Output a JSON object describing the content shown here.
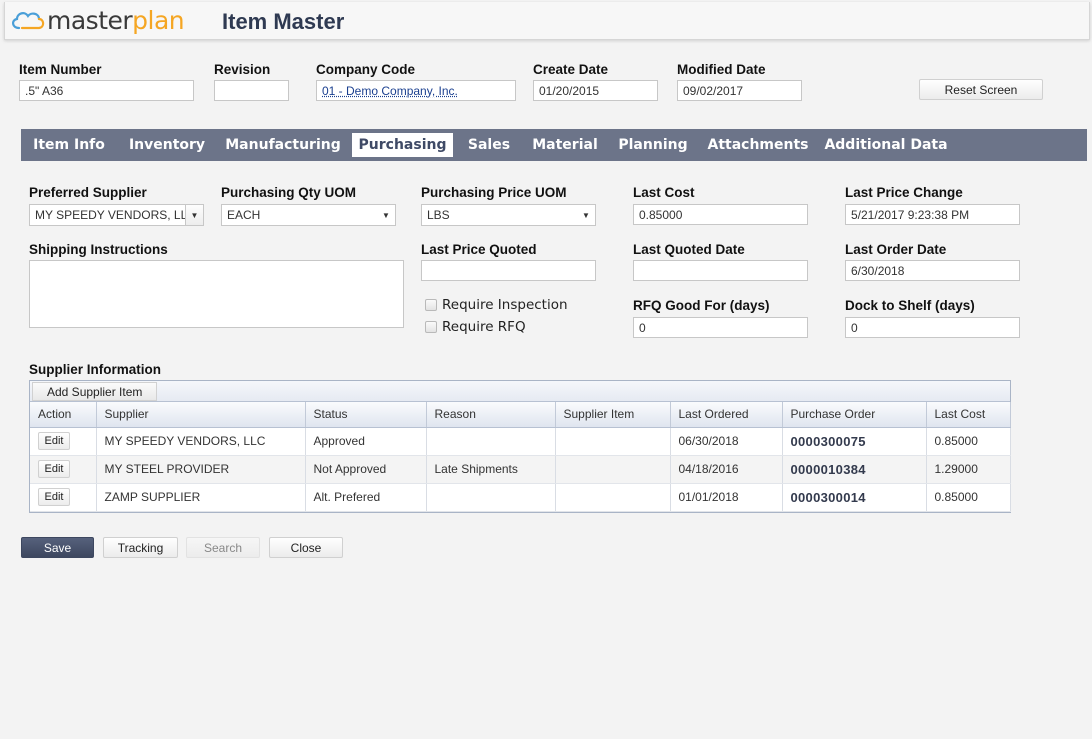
{
  "header": {
    "logo_prefix": "master",
    "logo_suffix": "plan",
    "title": "Item Master"
  },
  "top": {
    "item_number": {
      "label": "Item Number",
      "value": ".5\" A36"
    },
    "revision": {
      "label": "Revision",
      "value": ""
    },
    "company_code": {
      "label": "Company Code",
      "value": "01 - Demo Company, Inc."
    },
    "create_date": {
      "label": "Create Date",
      "value": "01/20/2015"
    },
    "modified_date": {
      "label": "Modified Date",
      "value": "09/02/2017"
    },
    "reset_button": "Reset Screen"
  },
  "tabs": [
    {
      "label": "Item Info",
      "active": false
    },
    {
      "label": "Inventory",
      "active": false
    },
    {
      "label": "Manufacturing",
      "active": false
    },
    {
      "label": "Purchasing",
      "active": true
    },
    {
      "label": "Sales",
      "active": false
    },
    {
      "label": "Material",
      "active": false
    },
    {
      "label": "Planning",
      "active": false
    },
    {
      "label": "Attachments",
      "active": false
    },
    {
      "label": "Additional Data",
      "active": false
    }
  ],
  "purchasing": {
    "preferred_supplier": {
      "label": "Preferred Supplier",
      "value": "MY SPEEDY VENDORS, LLC"
    },
    "qty_uom": {
      "label": "Purchasing Qty UOM",
      "value": "EACH"
    },
    "price_uom": {
      "label": "Purchasing Price UOM",
      "value": "LBS"
    },
    "last_cost": {
      "label": "Last Cost",
      "value": "0.85000"
    },
    "last_price_change": {
      "label": "Last Price Change",
      "value": "5/21/2017 9:23:38 PM"
    },
    "shipping_instructions": {
      "label": "Shipping Instructions",
      "value": ""
    },
    "last_price_quoted": {
      "label": "Last Price Quoted",
      "value": ""
    },
    "last_quoted_date": {
      "label": "Last Quoted Date",
      "value": ""
    },
    "last_order_date": {
      "label": "Last Order Date",
      "value": "6/30/2018"
    },
    "require_inspection": {
      "label": "Require Inspection",
      "checked": false
    },
    "require_rfq": {
      "label": "Require RFQ",
      "checked": false
    },
    "rfq_good_for": {
      "label": "RFQ Good For (days)",
      "value": "0"
    },
    "dock_to_shelf": {
      "label": "Dock to Shelf (days)",
      "value": "0"
    }
  },
  "supplier_info": {
    "title": "Supplier Information",
    "add_button": "Add Supplier Item",
    "columns": [
      "Action",
      "Supplier",
      "Status",
      "Reason",
      "Supplier Item",
      "Last Ordered",
      "Purchase Order",
      "Last Cost"
    ],
    "rows": [
      {
        "action": "Edit",
        "supplier": "MY SPEEDY VENDORS, LLC",
        "status": "Approved",
        "reason": "",
        "supplier_item": "",
        "last_ordered": "06/30/2018",
        "purchase_order": "0000300075",
        "last_cost": "0.85000"
      },
      {
        "action": "Edit",
        "supplier": "MY STEEL PROVIDER",
        "status": "Not Approved",
        "reason": "Late Shipments",
        "supplier_item": "",
        "last_ordered": "04/18/2016",
        "purchase_order": "0000010384",
        "last_cost": "1.29000"
      },
      {
        "action": "Edit",
        "supplier": "ZAMP SUPPLIER",
        "status": "Alt. Prefered",
        "reason": "",
        "supplier_item": "",
        "last_ordered": "01/01/2018",
        "purchase_order": "0000300014",
        "last_cost": "0.85000"
      }
    ]
  },
  "footer": {
    "save": "Save",
    "tracking": "Tracking",
    "search": "Search",
    "close": "Close"
  },
  "colors": {
    "tabbar": "#6c7489",
    "brand_dark": "#2f3a52",
    "logo_accent": "#f5a623",
    "save_button": "#46506a"
  }
}
